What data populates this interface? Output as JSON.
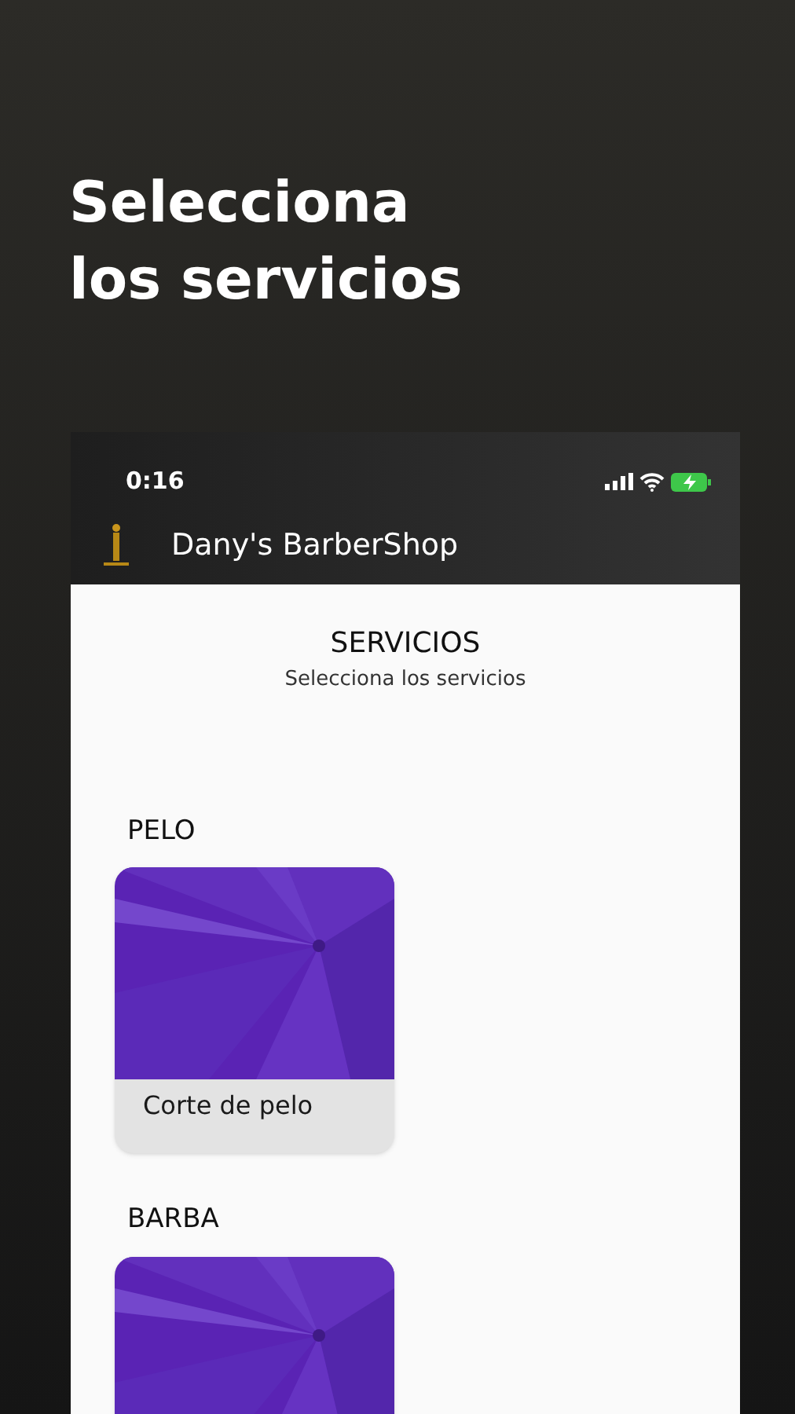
{
  "headline": [
    "Selecciona",
    "los servicios"
  ],
  "status_bar": {
    "time": "0:16"
  },
  "app_bar": {
    "title": "Dany's BarberShop"
  },
  "page": {
    "title": "SERVICIOS",
    "subtitle": "Selecciona los servicios"
  },
  "sections": [
    {
      "title": "PELO",
      "items": [
        {
          "kind": "picture",
          "label": "Corte de pelo"
        }
      ]
    },
    {
      "title": "BARBA"
    }
  ]
}
